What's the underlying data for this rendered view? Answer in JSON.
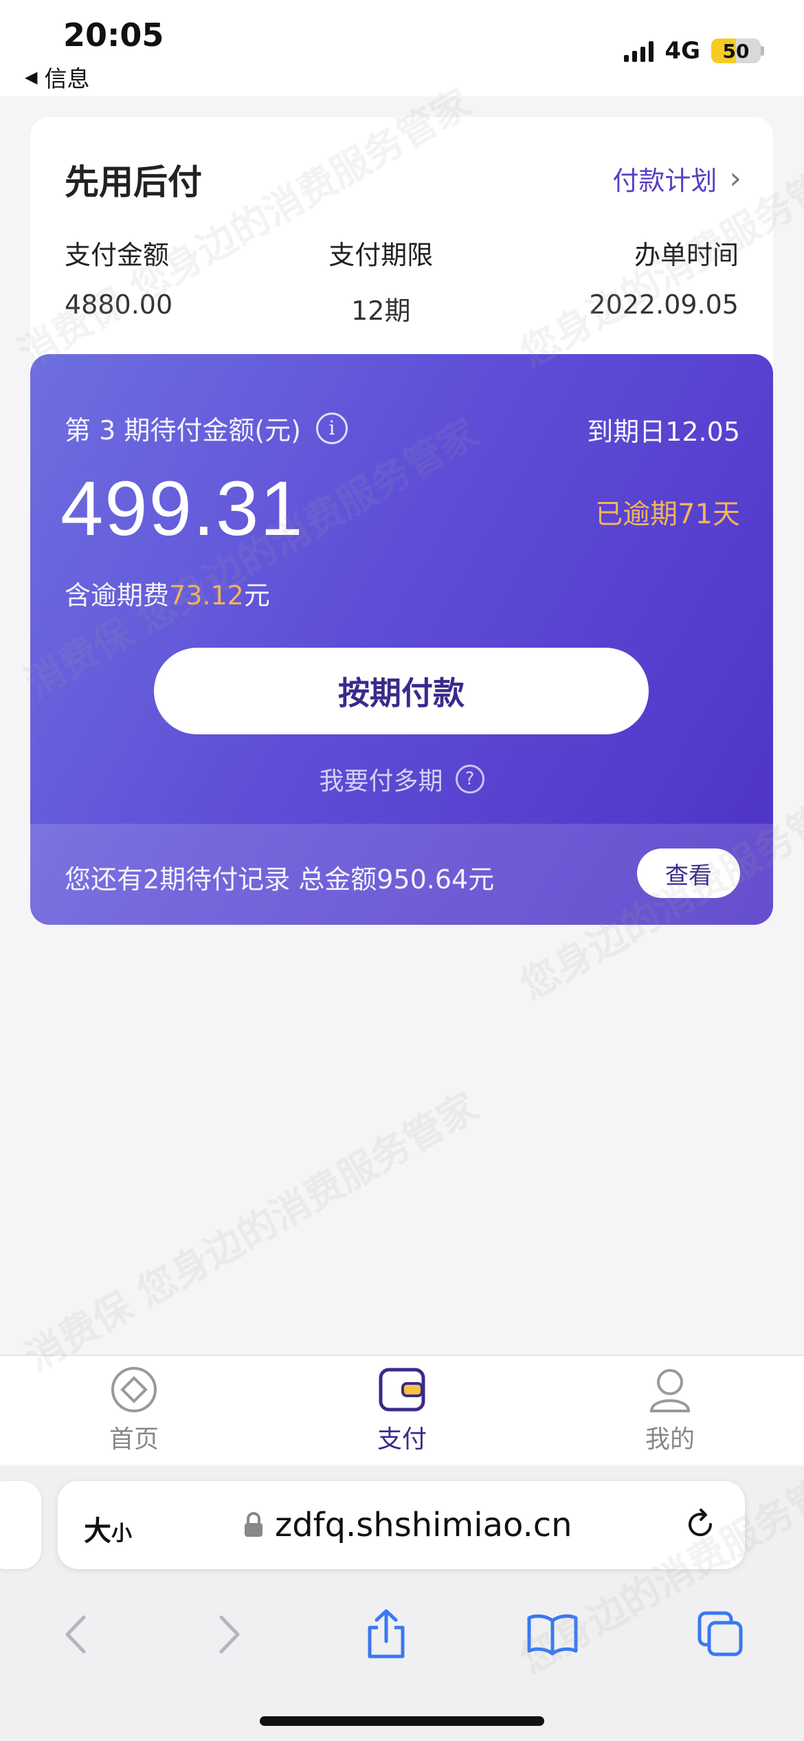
{
  "status_bar": {
    "time": "20:05",
    "back_label": "信息",
    "network": "4G",
    "battery": "50"
  },
  "summary": {
    "title": "先用后付",
    "plan_link": "付款计划",
    "columns": [
      {
        "label": "支付金额",
        "value": "4880.00"
      },
      {
        "label": "支付期限",
        "value": "12期"
      },
      {
        "label": "办单时间",
        "value": "2022.09.05"
      }
    ]
  },
  "installment": {
    "due_label": "第 3 期待付金额(元)",
    "due_date": "到期日12.05",
    "amount": "499.31",
    "overdue": "已逾期71天",
    "late_fee_prefix": "含逾期费",
    "late_fee_amount": "73.12",
    "late_fee_suffix": "元",
    "pay_button": "按期付款",
    "multi_pay": "我要付多期",
    "pending_text": "您还有2期待付记录 总金额950.64元",
    "view_button": "查看"
  },
  "tabs": [
    {
      "label": "首页",
      "icon": "home-icon",
      "active": false
    },
    {
      "label": "支付",
      "icon": "wallet-icon",
      "active": true
    },
    {
      "label": "我的",
      "icon": "profile-icon",
      "active": false
    }
  ],
  "browser": {
    "text_size_big": "大",
    "text_size_small": "小",
    "url": "zdfq.shshimiao.cn"
  },
  "watermark": {
    "text_a": "消费保 您身边的消费服务管家",
    "text_b": "您身边的消费服务管家 消费保"
  },
  "colors": {
    "accent": "#5a3fc2",
    "card_gradient_start": "#6e6fe0",
    "card_gradient_end": "#4e32c6",
    "warning": "#f4b35b"
  }
}
